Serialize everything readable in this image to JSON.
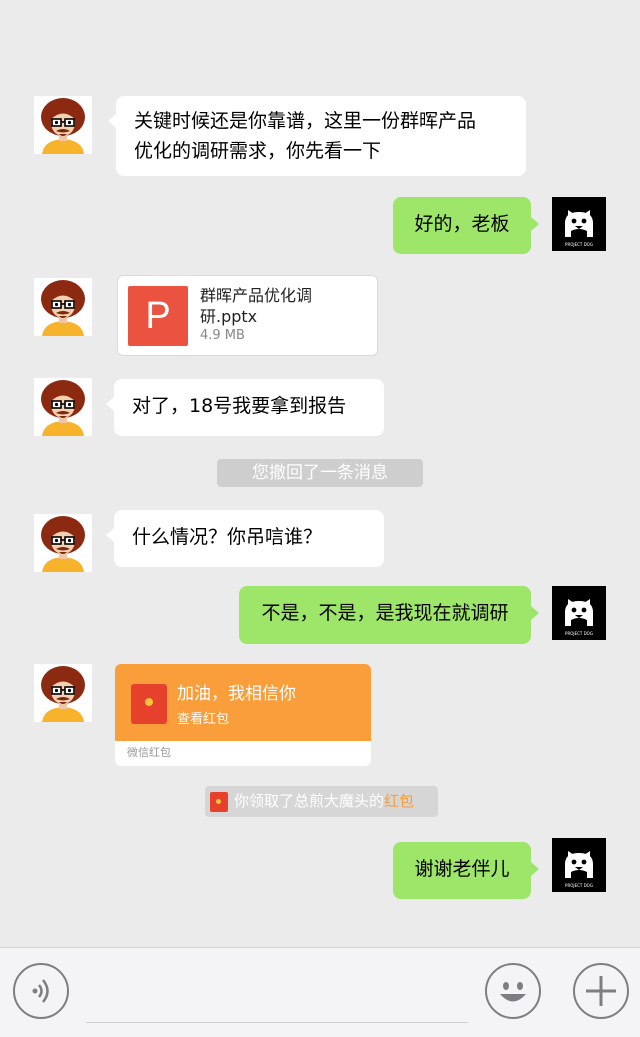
{
  "messages": [
    {
      "sender": "boss",
      "text_line1": "关键时候还是你靠谱，这里一份群晖产品",
      "text_line2": "优化的调研需求，你先看一下"
    },
    {
      "sender": "me",
      "text": "好的，老板"
    },
    {
      "sender": "boss",
      "type": "file",
      "file_name": "群晖产品优化调研.pptx",
      "file_size": "4.9 MB",
      "file_icon": "P"
    },
    {
      "sender": "boss",
      "text": "对了，18号我要拿到报告"
    },
    {
      "type": "system",
      "text": "您撤回了一条消息"
    },
    {
      "sender": "boss",
      "text": "什么情况？你吊唁谁？"
    },
    {
      "sender": "me",
      "text": "不是，不是，是我现在就调研"
    },
    {
      "sender": "boss",
      "type": "red_packet",
      "title": "加油，我相信你",
      "subtitle": "查看红包",
      "brand": "微信红包"
    },
    {
      "type": "system",
      "text_prefix": "你领取了总煎大魔头的",
      "text_accent": "红包"
    },
    {
      "sender": "me",
      "text": "谢谢老伴儿"
    }
  ],
  "avatar_me_caption": "PROJECT DOG",
  "input_bar": {
    "voice_icon": "voice-icon",
    "emoji_icon": "emoji-icon",
    "plus_icon": "plus-icon"
  },
  "colors": {
    "background": "#ebebeb",
    "sent_bubble": "#9ee66a",
    "received_bubble": "#ffffff",
    "ppt_icon": "#e9533f",
    "red_packet": "#fa9d3b"
  }
}
